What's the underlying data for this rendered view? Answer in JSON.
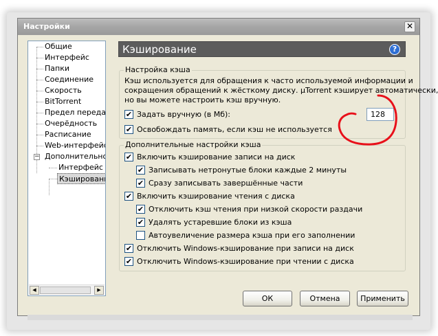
{
  "window": {
    "title": "Настройки",
    "close_glyph": "✕"
  },
  "tree": {
    "items": [
      {
        "label": "Общие"
      },
      {
        "label": "Интерфейс"
      },
      {
        "label": "Папки"
      },
      {
        "label": "Соединение"
      },
      {
        "label": "Скорость"
      },
      {
        "label": "BitTorrent"
      },
      {
        "label": "Предел передачи"
      },
      {
        "label": "Очерёдность"
      },
      {
        "label": "Расписание"
      },
      {
        "label": "Web-интерфейс"
      },
      {
        "label": "Дополнительно",
        "expanded": true
      },
      {
        "label": "Интерфейс"
      },
      {
        "label": "Кэширование",
        "selected": true
      }
    ],
    "expander_glyph": "−",
    "scroll_left": "◀",
    "scroll_right": "▶"
  },
  "panel": {
    "title": "Кэширование",
    "help_glyph": "?"
  },
  "cache_settings": {
    "legend": "Настройка кэша",
    "description": [
      "Кэш используется для обращения к часто используемой информации и",
      "сокращения обращений к жёсткому диску. µTorrent кэширует автоматически,",
      "но вы можете настроить кэш вручную."
    ],
    "manual_size_label": "Задать вручную (в Мб):",
    "manual_size_checked": true,
    "cache_size_value": "128",
    "free_memory_label": "Освобождать память, если кэш не используется",
    "free_memory_checked": true
  },
  "advanced_settings": {
    "legend": "Дополнительные настройки кэша",
    "options": [
      {
        "label": "Включить кэширование записи на диск",
        "checked": true,
        "level": 0
      },
      {
        "label": "Записывать нетронутые блоки каждые 2 минуты",
        "checked": true,
        "level": 1
      },
      {
        "label": "Сразу записывать завершённые части",
        "checked": true,
        "level": 1
      },
      {
        "label": "Включить кэширование чтения с диска",
        "checked": true,
        "level": 0
      },
      {
        "label": "Отключить кэш чтения при низкой скорости раздачи",
        "checked": true,
        "level": 1
      },
      {
        "label": "Удалять устаревшие блоки из кэша",
        "checked": true,
        "level": 1
      },
      {
        "label": "Автоувеличение размера кэша при его заполнении",
        "checked": false,
        "level": 1
      },
      {
        "label": "Отключить Windows-кэширование при записи на диск",
        "checked": true,
        "level": 0
      },
      {
        "label": "Отключить Windows-кэширование при чтении с диска",
        "checked": true,
        "level": 0
      }
    ]
  },
  "buttons": {
    "ok": "ОК",
    "cancel": "Отмена",
    "apply": "Применить"
  },
  "check_glyph": "✔",
  "colors": {
    "annotation_circle": "#e8101a",
    "header_bg": "#5c5c5c",
    "dialog_bg": "#ece9d8"
  }
}
